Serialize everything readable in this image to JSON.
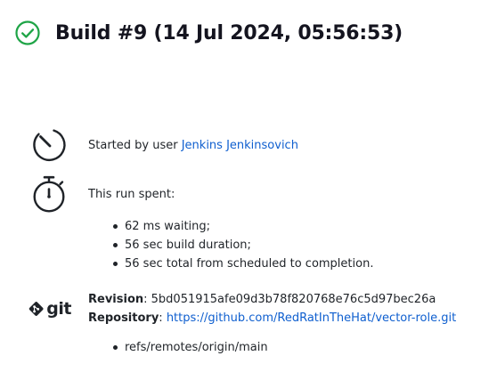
{
  "build": {
    "title": "Build #9 (14 Jul 2024, 05:56:53)"
  },
  "cause": {
    "prefix": "Started by user ",
    "user": "Jenkins Jenkinsovich"
  },
  "timing": {
    "label": "This run spent:",
    "items": [
      "62 ms waiting;",
      "56 sec build duration;",
      "56 sec total from scheduled to completion."
    ]
  },
  "scm": {
    "logo_text": "git",
    "revision_label": "Revision",
    "revision": "5bd051915afe09d3b78f820768e76c5d97bec26a",
    "repository_label": "Repository",
    "repository": "https://github.com/RedRatInTheHat/vector-role.git",
    "branches": [
      "refs/remotes/origin/main"
    ]
  },
  "colors": {
    "success": "#1ea446",
    "link": "#0f5fcf",
    "text": "#1f2328"
  },
  "icons": {
    "status": "check-circle-icon",
    "started_by": "clock-icon",
    "timing": "stopwatch-icon",
    "scm": "git-logo-icon"
  }
}
